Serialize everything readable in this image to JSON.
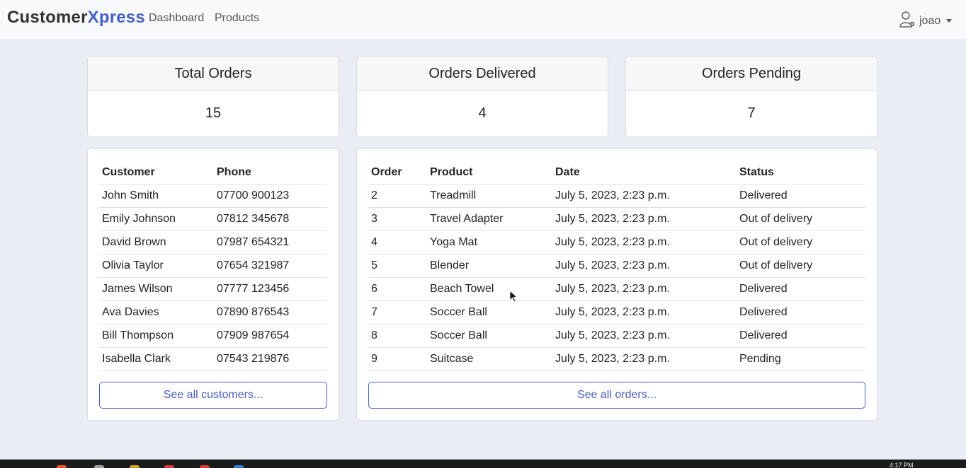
{
  "navbar": {
    "brand_part1": "Customer",
    "brand_part2": "Xpress",
    "links": [
      "Dashboard",
      "Products"
    ],
    "user": "joao",
    "user_icon": "user-gear-icon"
  },
  "stats": [
    {
      "title": "Total Orders",
      "value": "15"
    },
    {
      "title": "Orders Delivered",
      "value": "4"
    },
    {
      "title": "Orders Pending",
      "value": "7"
    }
  ],
  "customers": {
    "headers": [
      "Customer",
      "Phone"
    ],
    "rows": [
      [
        "John Smith",
        "07700 900123"
      ],
      [
        "Emily Johnson",
        "07812 345678"
      ],
      [
        "David Brown",
        "07987 654321"
      ],
      [
        "Olivia Taylor",
        "07654 321987"
      ],
      [
        "James Wilson",
        "07777 123456"
      ],
      [
        "Ava Davies",
        "07890 876543"
      ],
      [
        "Bill Thompson",
        "07909 987654"
      ],
      [
        "Isabella Clark",
        "07543 219876"
      ]
    ],
    "button": "See all customers..."
  },
  "orders": {
    "headers": [
      "Order",
      "Product",
      "Date",
      "Status"
    ],
    "rows": [
      [
        "2",
        "Treadmill",
        "July 5, 2023, 2:23 p.m.",
        "Delivered"
      ],
      [
        "3",
        "Travel Adapter",
        "July 5, 2023, 2:23 p.m.",
        "Out of delivery"
      ],
      [
        "4",
        "Yoga Mat",
        "July 5, 2023, 2:23 p.m.",
        "Out of delivery"
      ],
      [
        "5",
        "Blender",
        "July 5, 2023, 2:23 p.m.",
        "Out of delivery"
      ],
      [
        "6",
        "Beach Towel",
        "July 5, 2023, 2:23 p.m.",
        "Delivered"
      ],
      [
        "7",
        "Soccer Ball",
        "July 5, 2023, 2:23 p.m.",
        "Delivered"
      ],
      [
        "8",
        "Soccer Ball",
        "July 5, 2023, 2:23 p.m.",
        "Delivered"
      ],
      [
        "9",
        "Suitcase",
        "July 5, 2023, 2:23 p.m.",
        "Pending"
      ]
    ],
    "button": "See all orders..."
  },
  "taskbar": {
    "clock": "4:17 PM"
  },
  "colors": {
    "accent": "#4560c9",
    "background": "#eaedf4",
    "navbar": "#f8f9fa"
  }
}
